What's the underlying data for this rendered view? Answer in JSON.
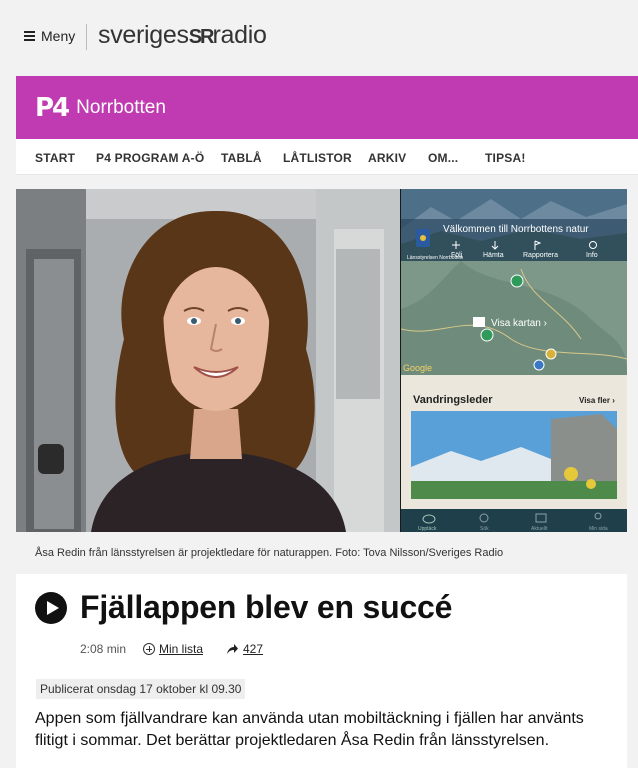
{
  "header": {
    "menu_label": "Meny",
    "logo_left": "sveriges",
    "logo_mid": "SR",
    "logo_right": "radio"
  },
  "channel": {
    "badge": "P4",
    "name": "Norrbotten",
    "color": "#c03ab1"
  },
  "nav": {
    "items": [
      "START",
      "P4 PROGRAM A-Ö",
      "TABLÅ",
      "LÅTLISTOR",
      "ARKIV",
      "OM...",
      "TIPSA!"
    ]
  },
  "hero": {
    "app": {
      "welcome": "Välkommen till Norrbottens natur",
      "agency": "Länsstyrelsen Norrbotten",
      "actions": [
        "Följ",
        "Hämta",
        "Rapportera",
        "Info"
      ],
      "map_button": "Visa kartan",
      "map_brand": "Google",
      "section_title": "Vandringsleder",
      "section_link": "Visa fler",
      "tabs": [
        "Upptäck",
        "Sök",
        "Aktuellt",
        "Min sida"
      ]
    }
  },
  "caption": "Åsa Redin från länsstyrelsen är projektledare för naturappen. Foto: Tova Nilsson/Sveriges Radio",
  "article": {
    "title": "Fjällappen blev en succé",
    "duration": "2:08 min",
    "my_list": "Min lista",
    "share_count": "427",
    "published": "Publicerat onsdag 17 oktober kl 09.30",
    "lead": "Appen som fjällvandrare kan använda utan mobiltäckning i fjällen har använts flitigt i sommar. Det berättar projektledaren Åsa Redin från länsstyrelsen."
  }
}
